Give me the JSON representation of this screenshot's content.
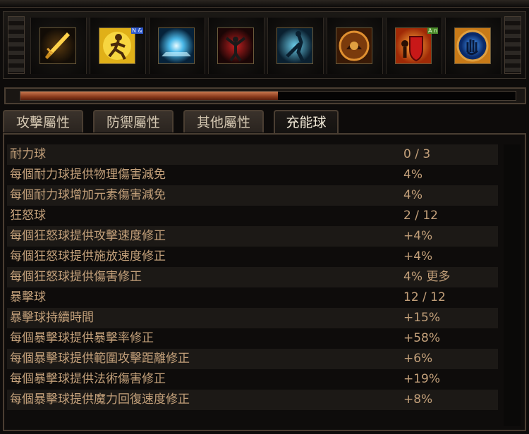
{
  "skills": [
    {
      "name": "sword-skill-icon",
      "badge": ""
    },
    {
      "name": "runner-skill-icon",
      "badge": "N &",
      "badge_color": "blue"
    },
    {
      "name": "ice-nova-skill-icon",
      "badge": ""
    },
    {
      "name": "blood-warrior-skill-icon",
      "badge": ""
    },
    {
      "name": "phase-run-skill-icon",
      "badge": ""
    },
    {
      "name": "warcry-skill-icon",
      "badge": ""
    },
    {
      "name": "shield-skill-icon",
      "badge": "A n",
      "badge_color": "green"
    },
    {
      "name": "spirit-hand-skill-icon",
      "badge": ""
    }
  ],
  "bar": {
    "fill": 0.52
  },
  "tabs": [
    "攻擊屬性",
    "防禦屬性",
    "其他屬性",
    "充能球"
  ],
  "active_tab": 3,
  "rows": [
    {
      "label": "耐力球",
      "value": "0 / 3"
    },
    {
      "label": "每個耐力球提供物理傷害減免",
      "value": "4%"
    },
    {
      "label": "每個耐力球增加元素傷害減免",
      "value": "4%"
    },
    {
      "label": "狂怒球",
      "value": "2 / 12"
    },
    {
      "label": "每個狂怒球提供攻擊速度修正",
      "value": "+4%"
    },
    {
      "label": "每個狂怒球提供施放速度修正",
      "value": "+4%"
    },
    {
      "label": "每個狂怒球提供傷害修正",
      "value": "4% 更多"
    },
    {
      "label": "暴擊球",
      "value": "12 / 12"
    },
    {
      "label": "暴擊球持續時間",
      "value": "+15%"
    },
    {
      "label": "每個暴擊球提供暴擊率修正",
      "value": "+58%"
    },
    {
      "label": "每個暴擊球提供範圍攻擊距離修正",
      "value": "+6%"
    },
    {
      "label": "每個暴擊球提供法術傷害修正",
      "value": "+19%"
    },
    {
      "label": "每個暴擊球提供魔力回復速度修正",
      "value": "+8%"
    }
  ]
}
